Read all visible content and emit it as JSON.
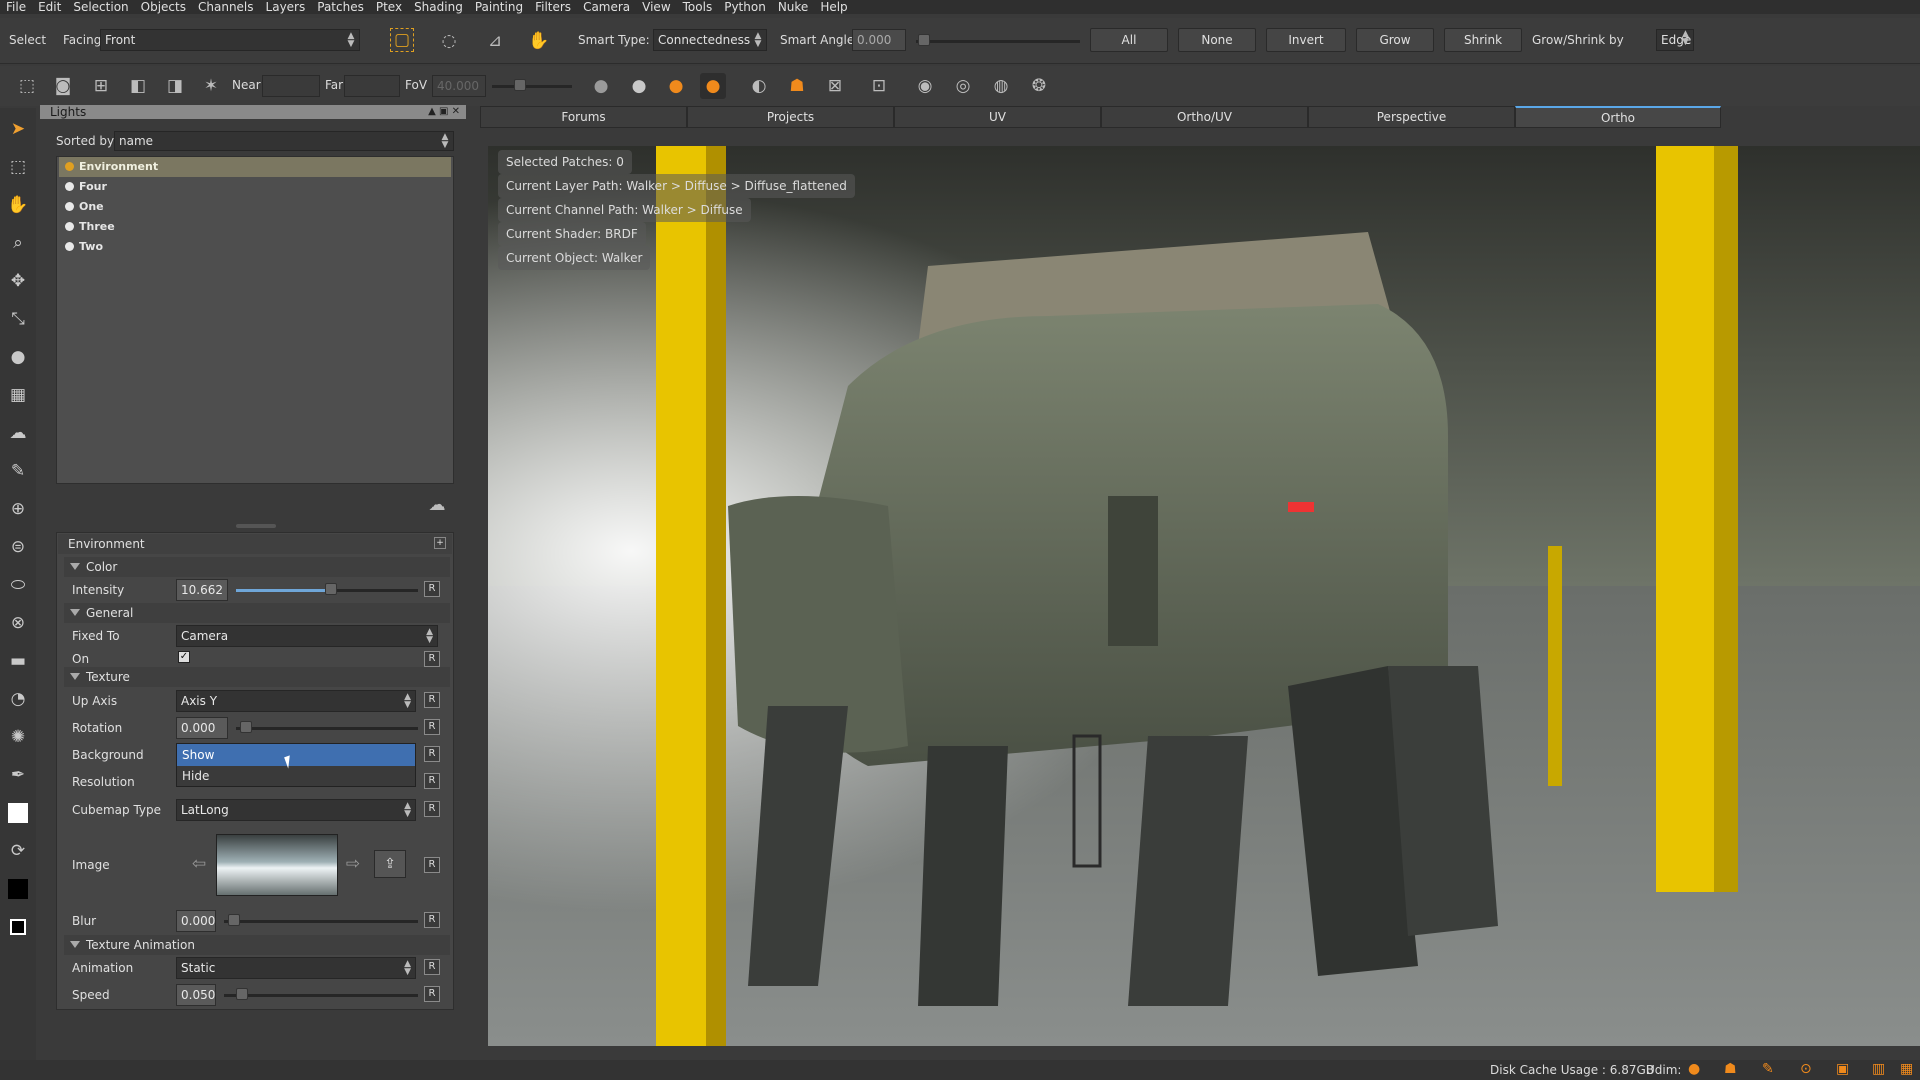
{
  "menubar": [
    "File",
    "Edit",
    "Selection",
    "Objects",
    "Channels",
    "Layers",
    "Patches",
    "Ptex",
    "Shading",
    "Painting",
    "Filters",
    "Camera",
    "View",
    "Tools",
    "Python",
    "Nuke",
    "Help"
  ],
  "toolbar": {
    "select_label": "Select",
    "facing_label": "Facing",
    "facing_value": "Front",
    "smart_type_label": "Smart Type:",
    "smart_type_value": "Connectedness",
    "smart_angle_label": "Smart Angle",
    "smart_angle_value": "0.000",
    "btn_all": "All",
    "btn_none": "None",
    "btn_invert": "Invert",
    "btn_grow": "Grow",
    "btn_shrink": "Shrink",
    "grow_shrink_label": "Grow/Shrink by",
    "grow_shrink_value": "Edge",
    "near_label": "Near",
    "far_label": "Far",
    "fov_label": "FoV",
    "fov_value": "40.000"
  },
  "lights_panel": {
    "title": "Lights",
    "sorted_by_label": "Sorted by",
    "sorted_by_value": "name",
    "items": [
      "Environment",
      "Four",
      "One",
      "Three",
      "Two"
    ],
    "selected": "Environment"
  },
  "properties": {
    "title": "Environment",
    "sections": {
      "color": "Color",
      "general": "General",
      "texture": "Texture",
      "texture_animation": "Texture Animation"
    },
    "intensity_label": "Intensity",
    "intensity_value": "10.662",
    "intensity_fraction": 0.52,
    "fixed_to_label": "Fixed To",
    "fixed_to_value": "Camera",
    "on_label": "On",
    "up_axis_label": "Up Axis",
    "up_axis_value": "Axis Y",
    "rotation_label": "Rotation",
    "rotation_value": "0.000",
    "background_label": "Background",
    "background_options": [
      "Show",
      "Hide"
    ],
    "background_highlight": "Show",
    "resolution_label": "Resolution",
    "cubemap_label": "Cubemap Type",
    "cubemap_value": "LatLong",
    "image_label": "Image",
    "blur_label": "Blur",
    "blur_value": "0.000",
    "animation_label": "Animation",
    "animation_value": "Static",
    "speed_label": "Speed",
    "speed_value": "0.050",
    "reset_label": "R"
  },
  "tabs": [
    "Forums",
    "Projects",
    "UV",
    "Ortho/UV",
    "Perspective",
    "Ortho"
  ],
  "active_tab": "Ortho",
  "hud": [
    "Selected Patches: 0",
    "Current Layer Path: Walker > Diffuse > Diffuse_flattened",
    "Current Channel Path: Walker > Diffuse",
    "Current Shader: BRDF",
    "Current Object: Walker"
  ],
  "status": {
    "disk_cache": "Disk Cache Usage : 6.87GB",
    "udim": "Udim:"
  },
  "colors": {
    "accent": "#5aa7e8",
    "selection_highlight": "#3f6fb0",
    "orange_icon": "#f08a1c",
    "pillar_yellow": "#e8c400"
  }
}
